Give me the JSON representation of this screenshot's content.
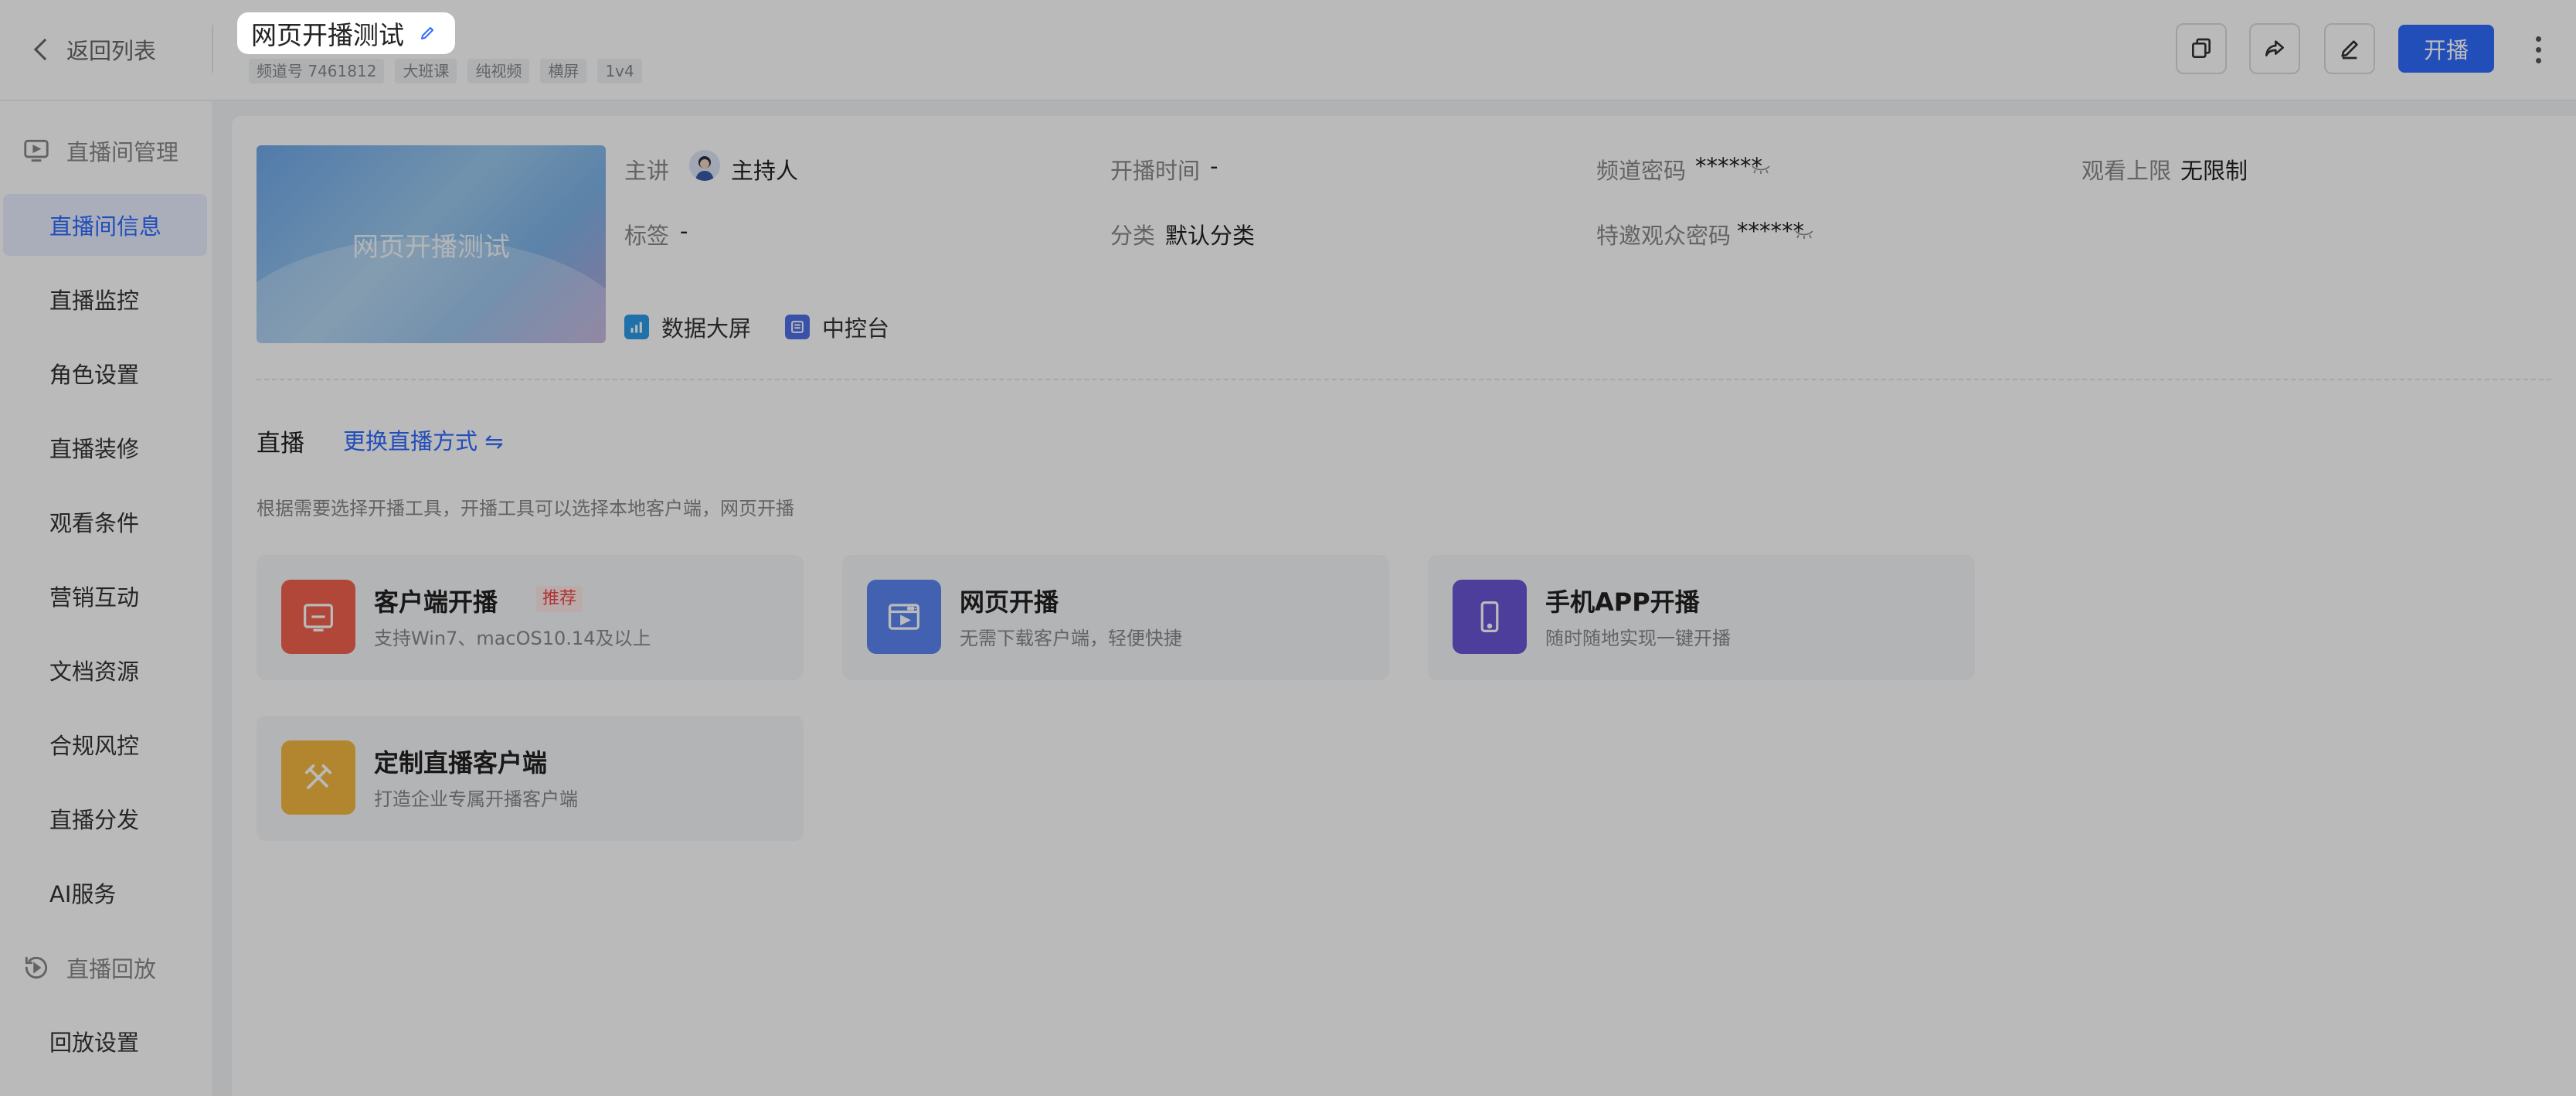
{
  "header": {
    "back_label": "返回列表",
    "title": "网页开播测试",
    "tags": [
      "频道号 7461812",
      "大班课",
      "纯视频",
      "横屏",
      "1v4"
    ],
    "primary_label": "开播"
  },
  "sidebar": {
    "group_live": "直播间管理",
    "items": [
      "直播间信息",
      "直播监控",
      "角色设置",
      "直播装修",
      "观看条件",
      "营销互动",
      "文档资源",
      "合规风控",
      "直播分发",
      "AI服务"
    ],
    "group_replay": "直播回放",
    "replay_items": [
      "回放设置"
    ]
  },
  "info": {
    "cover_text": "网页开播测试",
    "host_label": "主讲",
    "host_value": "主持人",
    "start_label": "开播时间",
    "start_value": "-",
    "pwd_label": "频道密码",
    "pwd_value": "******",
    "limit_label": "观看上限",
    "limit_value": "无限制",
    "tag_label": "标签",
    "tag_value": "-",
    "category_label": "分类",
    "category_value": "默认分类",
    "vip_pwd_label": "特邀观众密码",
    "vip_pwd_value": "******",
    "quick_data": "数据大屏",
    "quick_console": "中控台"
  },
  "live": {
    "section_title": "直播",
    "switch_label": "更换直播方式 ⇋",
    "hint": "根据需要选择开播工具，开播工具可以选择本地客户端，网页开播",
    "cards": [
      {
        "title": "客户端开播",
        "badge": "推荐",
        "desc": "支持Win7、macOS10.14及以上"
      },
      {
        "title": "网页开播",
        "desc": "无需下载客户端，轻便快捷"
      },
      {
        "title": "手机APP开播",
        "desc": "随时随地实现一键开播"
      },
      {
        "title": "定制直播客户端",
        "desc": "打造企业专属开播客户端"
      }
    ]
  },
  "colors": {
    "primary": "#2f6bff",
    "client_icon": "#f2624f",
    "web_icon": "#5b86f2",
    "app_icon": "#6a55d6",
    "custom_icon": "#f5b841"
  }
}
